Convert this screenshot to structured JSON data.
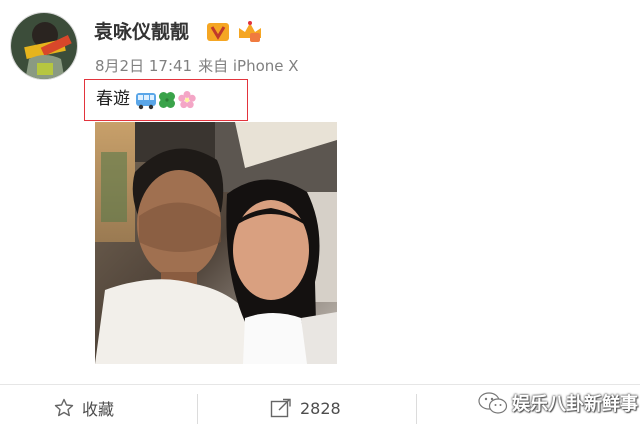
{
  "post": {
    "username": "袁咏仪靓靓",
    "date": "8月2日 17:41",
    "source": "来自 iPhone X",
    "text": "春遊",
    "emojis": [
      "bus-emoji",
      "clover-emoji",
      "blossom-emoji"
    ]
  },
  "actions": {
    "favorite_label": "收藏",
    "repost_count": "2828"
  },
  "watermark": {
    "text": "娱乐八卦新鲜事"
  },
  "colors": {
    "highlight_box": "#e2343d",
    "verified_badge": "#f5a623",
    "username": "#333333",
    "meta": "#808080"
  }
}
